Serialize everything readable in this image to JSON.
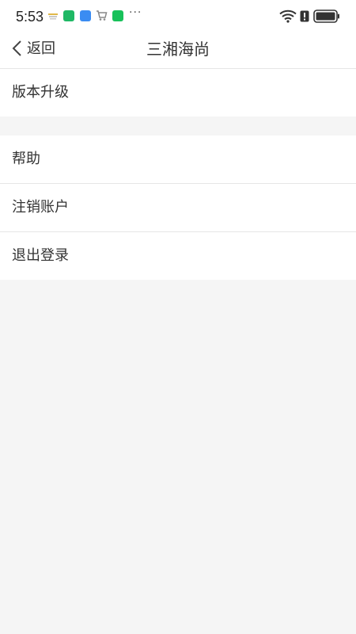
{
  "status_bar": {
    "time": "5:53",
    "more_indicator": "···",
    "icons": [
      "weather-notification-icon",
      "green-app-notification-icon",
      "blue-app-notification-icon",
      "cart-notification-icon",
      "wechat-notification-icon",
      "wifi-icon",
      "alert-icon",
      "battery-icon"
    ]
  },
  "nav": {
    "back_label": "返回",
    "back_icon": "chevron-left-icon",
    "title": "三湘海尚"
  },
  "menu": {
    "groups": [
      {
        "items": [
          {
            "label": "版本升级"
          }
        ]
      },
      {
        "items": [
          {
            "label": "帮助"
          },
          {
            "label": "注销账户"
          },
          {
            "label": "退出登录"
          }
        ]
      }
    ]
  },
  "colors": {
    "background": "#f5f5f5",
    "surface": "#ffffff",
    "divider": "#e6e6e6",
    "text": "#333333"
  }
}
